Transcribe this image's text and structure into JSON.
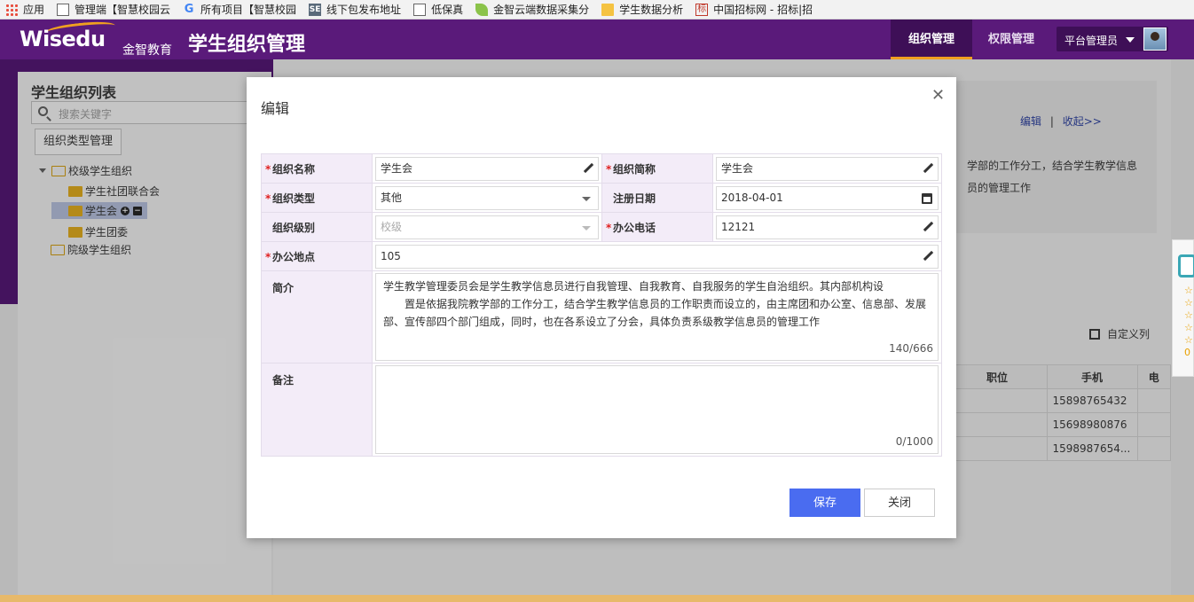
{
  "bookmarks": [
    {
      "icon": "apps-icon",
      "label": "应用"
    },
    {
      "icon": "page-icon",
      "label": "管理端【智慧校园云"
    },
    {
      "icon": "google-icon",
      "label": "所有项目【智慧校园"
    },
    {
      "icon": "se-icon",
      "label": "线下包发布地址"
    },
    {
      "icon": "page-icon",
      "label": "低保真"
    },
    {
      "icon": "leaf-icon",
      "label": "金智云端数据采集分"
    },
    {
      "icon": "folder-icon",
      "label": "学生数据分析"
    },
    {
      "icon": "biao-icon",
      "label": "中国招标网 - 招标|招"
    }
  ],
  "header": {
    "logo": "Wisedu",
    "brand": "金智教育",
    "title": "学生组织管理",
    "tabs": [
      {
        "label": "组织管理",
        "active": true
      },
      {
        "label": "权限管理",
        "active": false
      }
    ],
    "user": "平台管理员"
  },
  "sidebar": {
    "title": "学生组织列表",
    "search_placeholder": "搜索关键字",
    "type_button": "组织类型管理",
    "tree": [
      {
        "label": "校级学生组织",
        "level": 0
      },
      {
        "label": "学生社团联合会",
        "level": 1
      },
      {
        "label": "学生会",
        "level": 1,
        "selected": true
      },
      {
        "label": "学生团委",
        "level": 1
      },
      {
        "label": "院级学生组织",
        "level": 0
      }
    ]
  },
  "background": {
    "edit_link": "编辑",
    "separator": "|",
    "collapse_link": "收起>>",
    "desc_line1": "学部的工作分工，结合学生教学信息",
    "desc_line2": "员的管理工作",
    "custom_columns": "自定义列",
    "table": {
      "headers": [
        "职位",
        "手机",
        "电"
      ],
      "rows": [
        [
          "",
          "15898765432",
          ""
        ],
        [
          "",
          "15698980876",
          ""
        ],
        [
          "",
          "1598987654...",
          ""
        ]
      ]
    },
    "float_widget_count": "0"
  },
  "modal": {
    "title": "编辑",
    "fields": {
      "org_name": {
        "label": "组织名称",
        "value": "学生会",
        "required": true
      },
      "org_short": {
        "label": "组织简称",
        "value": "学生会",
        "required": true
      },
      "org_type": {
        "label": "组织类型",
        "value": "其他",
        "required": true
      },
      "reg_date": {
        "label": "注册日期",
        "value": "2018-04-01",
        "required": false
      },
      "org_level": {
        "label": "组织级别",
        "value": "校级",
        "required": false
      },
      "phone": {
        "label": "办公电话",
        "value": "12121",
        "required": true
      },
      "address": {
        "label": "办公地点",
        "value": "105",
        "required": true
      },
      "intro": {
        "label": "简介",
        "line1": "学生教学管理委员会是学生教学信息员进行自我管理、自我教育、自我服务的学生自治组织。其内部机构设",
        "line2": "置是依据我院教学部的工作分工，结合学生教学信息员的工作职责而设立的，由主席团和办公室、信息部、发展",
        "line3": "部、宣传部四个部门组成，同时，也在各系设立了分会，具体负责系级教学信息员的管理工作",
        "counter": "140/666"
      },
      "remarks": {
        "label": "备注",
        "value": "",
        "counter": "0/1000"
      }
    },
    "save_label": "保存",
    "close_label": "关闭"
  }
}
